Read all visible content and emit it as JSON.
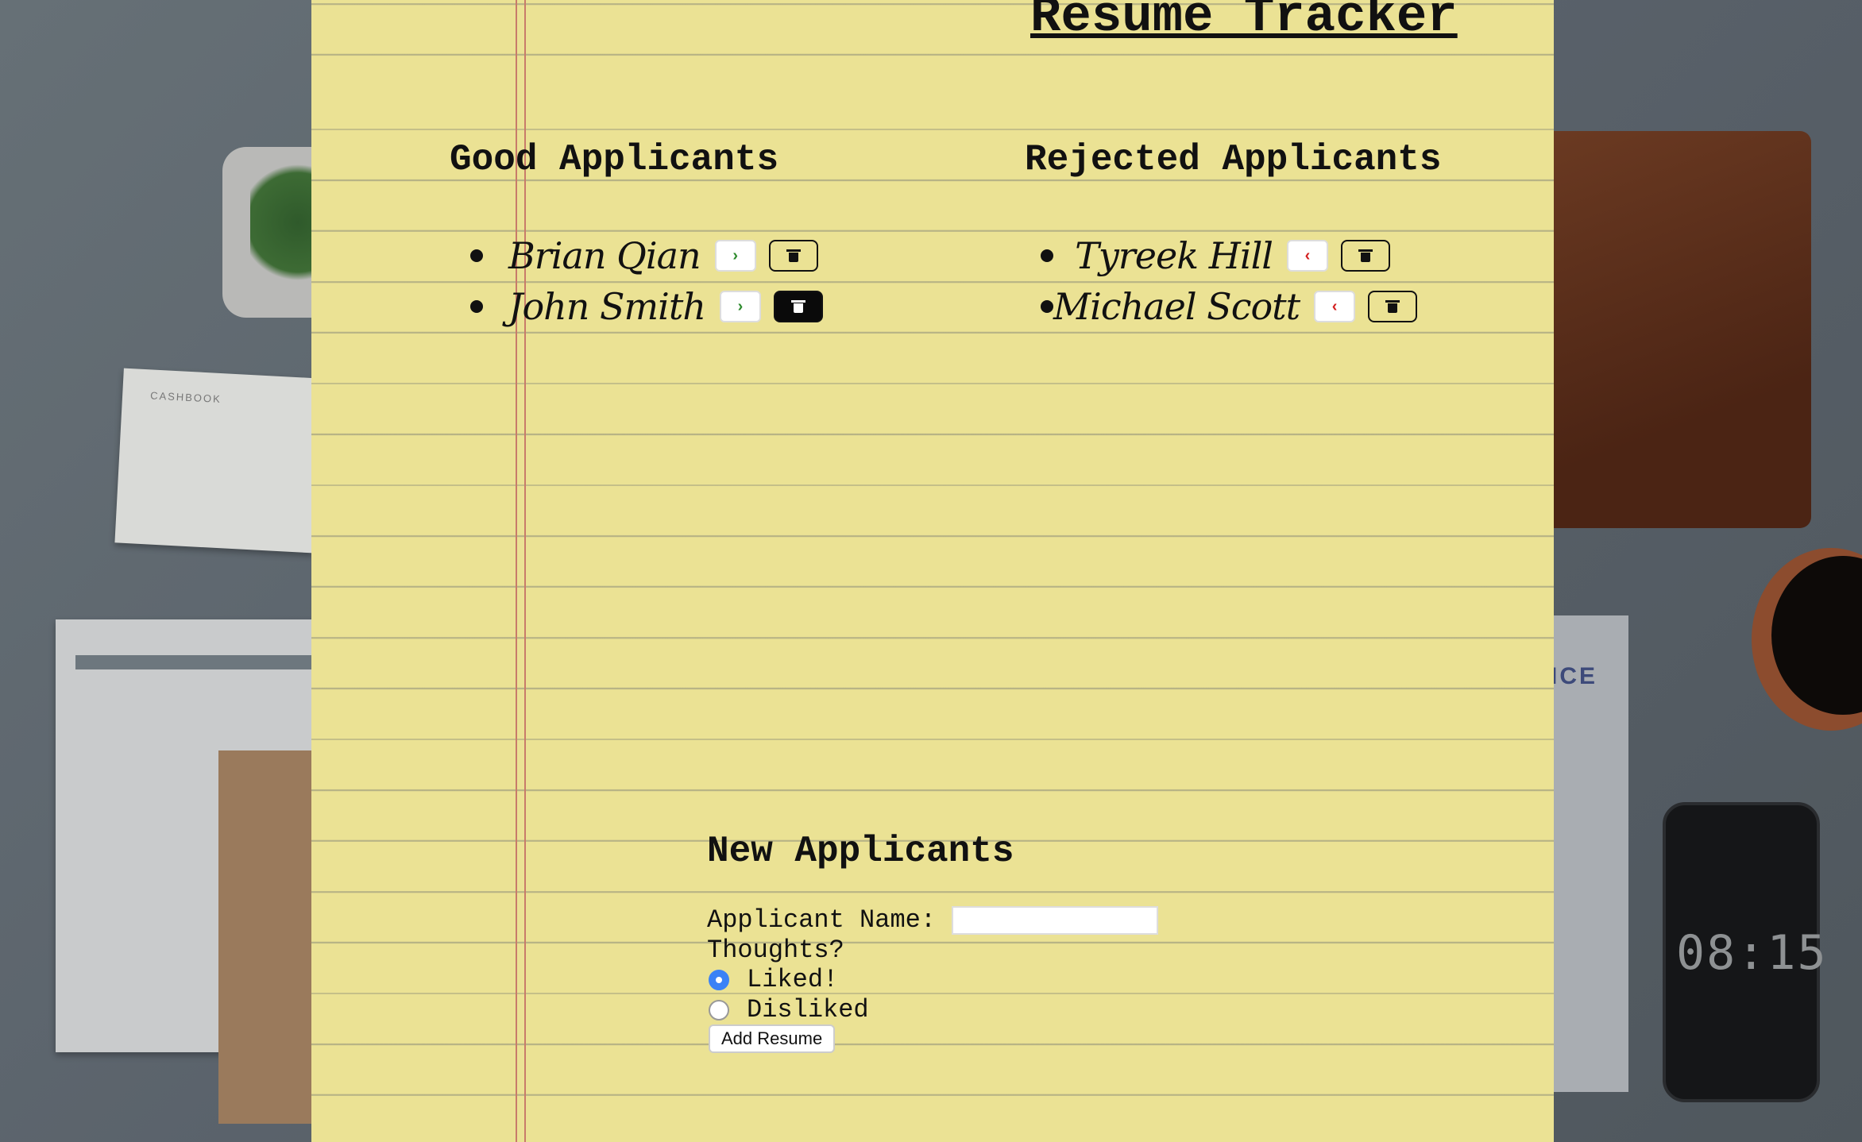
{
  "page": {
    "title": "Resume Tracker"
  },
  "good": {
    "heading": "Good Applicants",
    "items": [
      {
        "name": "Brian Qian"
      },
      {
        "name": "John Smith"
      }
    ]
  },
  "rejected": {
    "heading": "Rejected Applicants",
    "items": [
      {
        "name": "Tyreek Hill"
      },
      {
        "name": "Michael Scott"
      }
    ]
  },
  "form": {
    "heading": "New Applicants",
    "name_label": "Applicant Name:",
    "name_value": "",
    "thoughts_label": "Thoughts?",
    "liked_label": "Liked!",
    "disliked_label": "Disliked",
    "selected": "liked",
    "submit_label": "Add Resume"
  },
  "backdrop": {
    "cashbook_label": "CASHBOOK",
    "invoice_text": "ICE",
    "phone_time": "08:15"
  },
  "colors": {
    "paper": "#ebe294",
    "accept_arrow": "#2e8b2e",
    "reject_arrow": "#d32020",
    "radio_selected": "#3b82f6"
  }
}
